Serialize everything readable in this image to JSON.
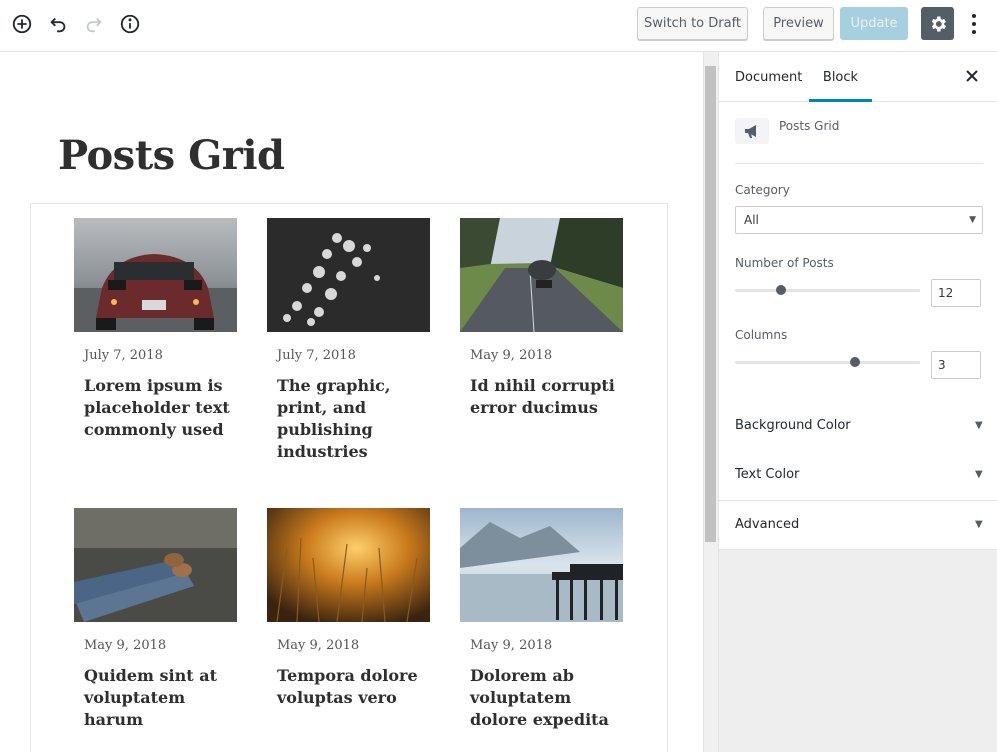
{
  "toolbar": {
    "add_block_icon": "plus-circle-icon",
    "undo_icon": "undo-icon",
    "redo_icon": "redo-icon",
    "info_icon": "info-icon",
    "switch_to_draft": "Switch to Draft",
    "preview": "Preview",
    "update": "Update",
    "settings_icon": "gear-icon",
    "more_icon": "more-vertical-icon"
  },
  "editor": {
    "page_title": "Posts Grid",
    "posts": [
      {
        "date": "July 7, 2018",
        "title": "Lorem ipsum is placeholder text commonly used",
        "image": "red-car-on-road"
      },
      {
        "date": "July 7, 2018",
        "title": "The graphic, print, and publishing industries",
        "image": "white-flowers-dark"
      },
      {
        "date": "May 9, 2018",
        "title": "Id nihil corrupti error ducimus",
        "image": "skateboarder-on-road"
      },
      {
        "date": "May 9, 2018",
        "title": "Quidem sint at voluptatem harum",
        "image": "legs-crossed-outdoors"
      },
      {
        "date": "May 9, 2018",
        "title": "Tempora dolore voluptas vero",
        "image": "golden-grass-sunset"
      },
      {
        "date": "May 9, 2018",
        "title": "Dolorem ab voluptatem dolore expedita",
        "image": "pier-on-lake"
      }
    ]
  },
  "sidebar": {
    "tabs": [
      "Document",
      "Block"
    ],
    "active_tab": "Block",
    "block_name": "Posts Grid",
    "block_icon": "megaphone-icon",
    "category_label": "Category",
    "category_value": "All",
    "number_of_posts_label": "Number of Posts",
    "number_of_posts_value": "12",
    "number_of_posts_slider": 0.25,
    "columns_label": "Columns",
    "columns_value": "3",
    "columns_slider": 0.65,
    "panels": [
      "Background Color",
      "Text Color",
      "Advanced"
    ]
  },
  "colors": {
    "accent": "#0085ba",
    "update_disabled": "#a6cfdf",
    "gear_bg": "#555d66"
  }
}
